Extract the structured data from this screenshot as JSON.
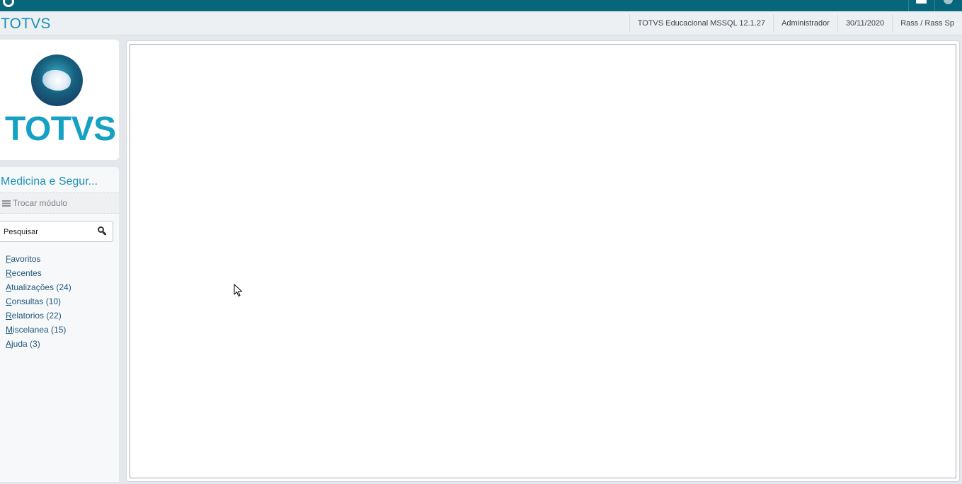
{
  "colors": {
    "topbar": "#08667c",
    "brand": "#1b8fb5",
    "logo_text": "#15a1c2",
    "menu_link": "#23587a"
  },
  "topbar": {
    "icons": [
      "totvs-small-logo-icon",
      "screen-icon",
      "info-icon"
    ]
  },
  "header": {
    "brand": "TOTVS",
    "environment": "TOTVS Educacional MSSQL 12.1.27",
    "user": "Administrador",
    "date": "30/11/2020",
    "company": "Rass / Rass Sp"
  },
  "logo": {
    "text": "TOTVS"
  },
  "sidebar": {
    "module_title": "Medicina e Segur...",
    "switch_module": {
      "label": "Trocar módulo",
      "icon": "hamburger-icon"
    },
    "search": {
      "placeholder": "Pesquisar",
      "icon": "search-icon"
    },
    "menu": [
      {
        "accel": "F",
        "rest": "avoritos"
      },
      {
        "accel": "R",
        "rest": "ecentes"
      },
      {
        "accel": "A",
        "rest": "tualizações (24)"
      },
      {
        "accel": "C",
        "rest": "onsultas (10)"
      },
      {
        "accel": "R",
        "rest": "elatorios (22)"
      },
      {
        "accel": "M",
        "rest": "iscelanea (15)"
      },
      {
        "accel": "A",
        "rest": "juda (3)"
      }
    ]
  }
}
